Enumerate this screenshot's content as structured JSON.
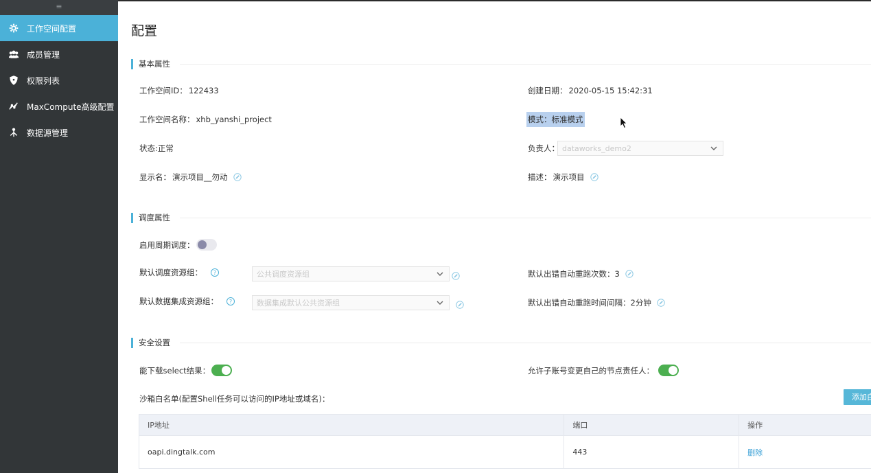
{
  "sidebar": {
    "toggle_glyph": "≡",
    "items": [
      {
        "label": "工作空间配置",
        "icon": "gear-icon",
        "active": true
      },
      {
        "label": "成员管理",
        "icon": "users-icon",
        "active": false
      },
      {
        "label": "权限列表",
        "icon": "shield-icon",
        "active": false
      },
      {
        "label": "MaxCompute高级配置",
        "icon": "chart-line-icon",
        "active": false
      },
      {
        "label": "数据源管理",
        "icon": "tree-icon",
        "active": false
      }
    ]
  },
  "page": {
    "title": "配置"
  },
  "basic": {
    "section_title": "基本属性",
    "workspace_id_label": "工作空间ID：",
    "workspace_id": "122433",
    "created_label": "创建日期：",
    "created": "2020-05-15 15:42:31",
    "workspace_name_label": "工作空间名称：",
    "workspace_name": "xhb_yanshi_project",
    "mode_label": "模式：",
    "mode": "标准模式",
    "status_label": "状态:",
    "status": "正常",
    "owner_label": "负责人：",
    "owner_value": "dataworks_demo2",
    "display_name_label": "显示名：",
    "display_name": "演示项目__勿动",
    "description_label": "描述：",
    "description": "演示项目"
  },
  "schedule": {
    "section_title": "调度属性",
    "periodic_label": "启用周期调度：",
    "periodic_enabled": false,
    "resource_group_label": "默认调度资源组：",
    "resource_group_value": "公共调度资源组",
    "integration_group_label": "默认数据集成资源组：",
    "integration_group_value": "数据集成默认公共资源组",
    "retry_count_label": "默认出错自动重跑次数：",
    "retry_count": "3",
    "retry_interval_label": "默认出错自动重跑时间间隔：",
    "retry_interval": "2分钟",
    "help_glyph": "?"
  },
  "security": {
    "section_title": "安全设置",
    "download_label": "能下载select结果：",
    "download_enabled": true,
    "sub_account_label": "允许子账号变更自己的节点责任人：",
    "sub_account_enabled": true,
    "whitelist_label": "沙箱白名单(配置Shell任务可以访问的IP地址或域名)：",
    "add_button": "添加白名单",
    "table": {
      "headers": [
        "IP地址",
        "端口",
        "操作"
      ],
      "rows": [
        {
          "ip": "oapi.dingtalk.com",
          "port": "443",
          "action": "删除"
        }
      ]
    }
  },
  "colors": {
    "accent": "#4bb1d8",
    "sidebar_bg": "#323638",
    "toggle_on": "#4caf50"
  }
}
